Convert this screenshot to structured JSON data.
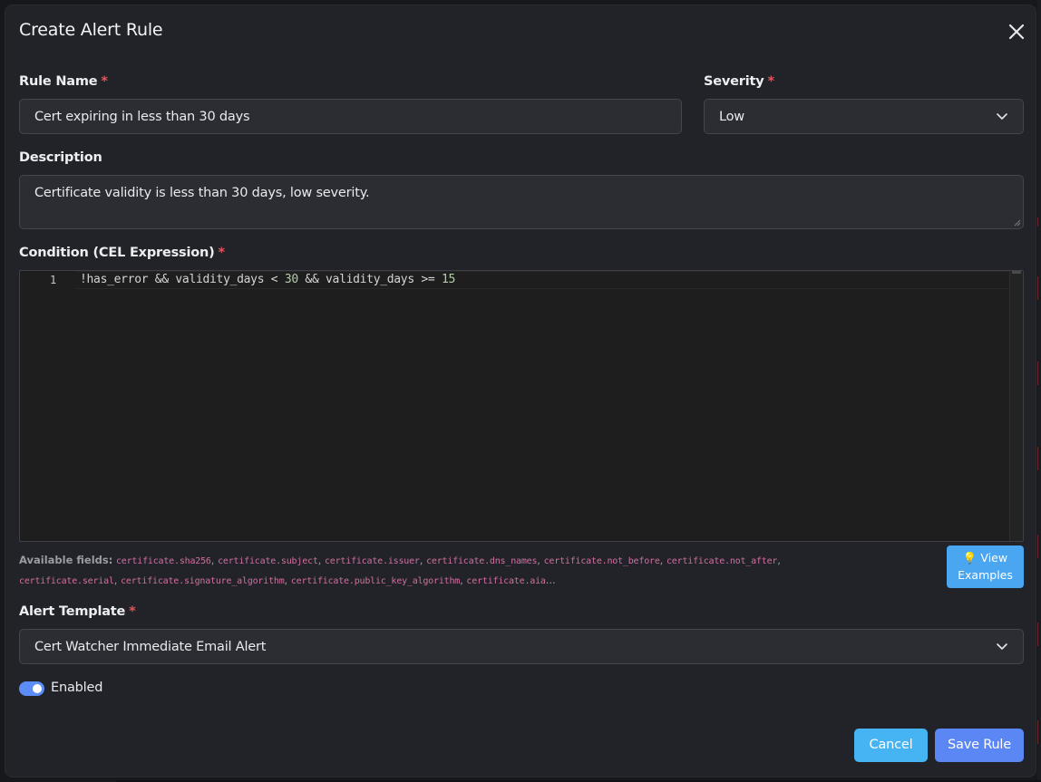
{
  "dialog": {
    "title": "Create Alert Rule"
  },
  "rule_name": {
    "label": "Rule Name",
    "required": "*",
    "value": "Cert expiring in less than 30 days"
  },
  "severity": {
    "label": "Severity",
    "required": "*",
    "value": "Low"
  },
  "description": {
    "label": "Description",
    "value": "Certificate validity is less than 30 days, low severity."
  },
  "condition": {
    "label": "Condition (CEL Expression)",
    "required": "*",
    "line_number": "1",
    "tokens": {
      "t1": "!has_error",
      "t2": " && ",
      "t3": "validity_days",
      "t4": " < ",
      "t5": "30",
      "t6": " && ",
      "t7": "validity_days",
      "t8": " >= ",
      "t9": "15"
    }
  },
  "available_fields": {
    "label": "Available fields:",
    "fields": [
      "certificate.sha256",
      "certificate.subject",
      "certificate.issuer",
      "certificate.dns_names",
      "certificate.not_before",
      "certificate.not_after",
      "certificate.serial",
      "certificate.signature_algorithm",
      "certificate.public_key_algorithm",
      "certificate.aia"
    ],
    "ellipsis": "..."
  },
  "view_examples": {
    "icon": "lightbulb-icon",
    "line1": "💡 View",
    "line2": "Examples"
  },
  "alert_template": {
    "label": "Alert Template",
    "required": "*",
    "value": "Cert Watcher Immediate Email Alert"
  },
  "enabled": {
    "label": "Enabled",
    "on": true
  },
  "actions": {
    "cancel": "Cancel",
    "save": "Save Rule"
  },
  "colors": {
    "modal_bg": "#212328",
    "field_bg": "#2b2d33",
    "required": "#e4555a",
    "primary": "#5b87f5",
    "info": "#46b3f2",
    "field_code": "#d26fa1"
  }
}
